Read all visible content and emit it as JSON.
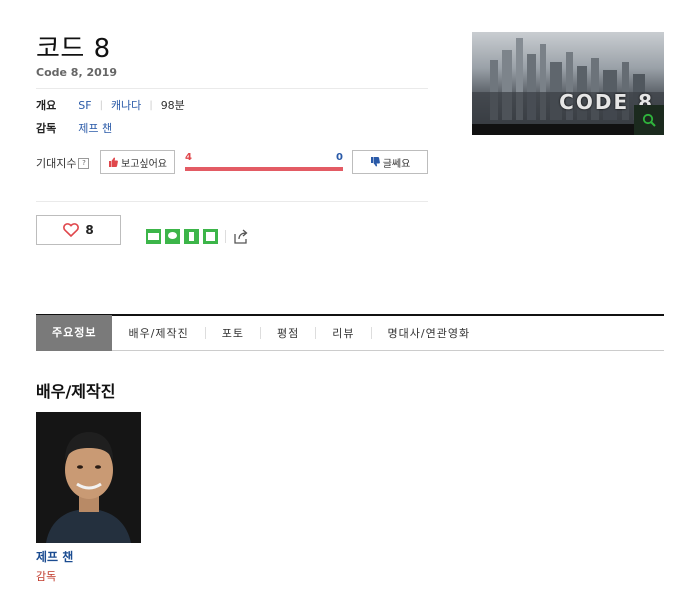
{
  "movie": {
    "title": "코드 8",
    "subtitle": "Code 8, 2019"
  },
  "overview": {
    "label": "개요",
    "genre": "SF",
    "country": "캐나다",
    "runtime": "98분"
  },
  "director": {
    "label": "감독",
    "name": "제프 챈"
  },
  "expectation": {
    "label": "기대지수",
    "help_icon": "?",
    "want_label": "보고싶어요",
    "want_count": "4",
    "not_sure_count": "0",
    "not_sure_label": "글쎄요",
    "want_fraction": 1.0,
    "bar_color": "#e35b64"
  },
  "like": {
    "count": "8",
    "heart_color": "#e0474c"
  },
  "share_icons": [
    "blog-icon",
    "talk-icon",
    "bookmark-icon",
    "green-square-icon",
    "share-icon"
  ],
  "poster": {
    "logo_text": "CODE 8"
  },
  "tabs": [
    "주요정보",
    "배우/제작진",
    "포토",
    "평점",
    "리뷰",
    "명대사/연관영화"
  ],
  "cast_section": {
    "title": "배우/제작진",
    "person": {
      "name": "제프 챈",
      "role": "감독"
    }
  }
}
